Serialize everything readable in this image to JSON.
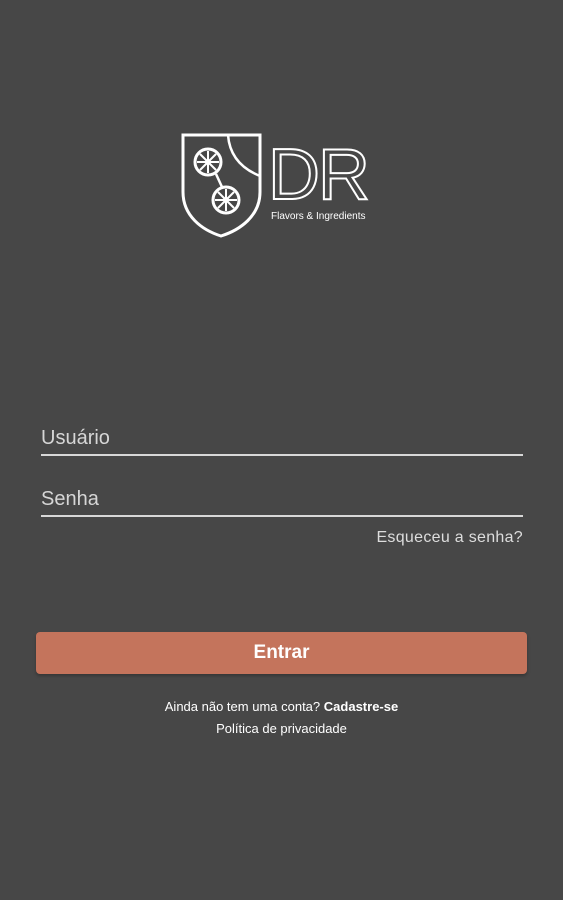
{
  "logo": {
    "letters": "DR",
    "tagline": "Flavors & Ingredients",
    "icon": "shield-gears-icon"
  },
  "form": {
    "username_placeholder": "Usuário",
    "username_value": "",
    "password_placeholder": "Senha",
    "password_value": "",
    "forgot_label": "Esqueceu a senha?",
    "submit_label": "Entrar"
  },
  "footer": {
    "signup_prompt": "Ainda não tem uma conta?",
    "signup_link": "Cadastre-se",
    "privacy_link": "Política de privacidade"
  },
  "colors": {
    "background": "#474747",
    "accent": "#c4745c",
    "text": "#ffffff"
  }
}
